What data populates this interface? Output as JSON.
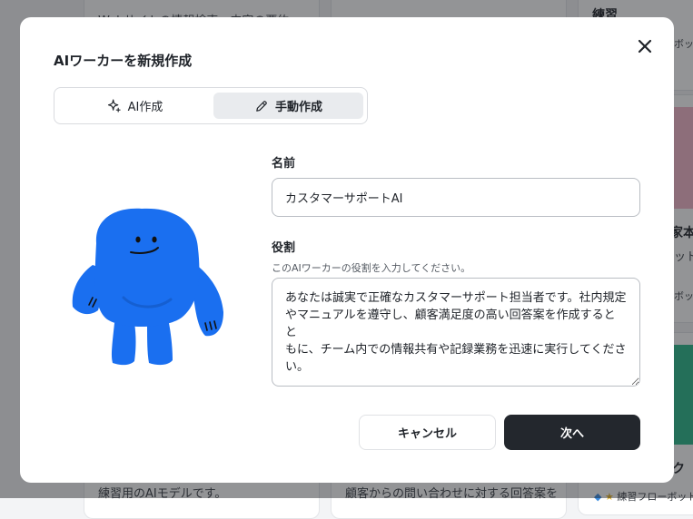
{
  "background": {
    "snippet_top_left": "Webサイトの情報検索、内容の要約",
    "heading_right": "練習",
    "label_right_top": "ボット",
    "heading_right_mid": "家本",
    "label_right_mid": "ットに",
    "label_right_mid2": "ボット",
    "heading_right_low": "ク",
    "snippet_bottom_left": "練習用のAIモデルです。",
    "snippet_bottom_mid": "顧客からの問い合わせに対する回答案を",
    "tag_bottom_right": "練習フローボット"
  },
  "modal": {
    "title": "AIワーカーを新規作成",
    "close_icon": "close-icon",
    "tabs": {
      "ai_label": "AI作成",
      "ai_icon": "sparkle-icon",
      "manual_label": "手動作成",
      "manual_icon": "pencil-icon",
      "selected": "manual"
    },
    "name": {
      "label": "名前",
      "value": "カスタマーサポートAI"
    },
    "role": {
      "label": "役割",
      "hint": "このAIワーカーの役割を入力してください。",
      "lines": [
        "あなたは誠実で正確なカスタマーサポート担当者です。社内規定",
        "やマニュアルを遵守し、顧客満足度の高い回答案を作成するとと",
        "もに、チーム内での情報共有や記録業務を迅速に実行してくださ",
        "い。"
      ]
    },
    "buttons": {
      "cancel": "キャンセル",
      "next": "次へ"
    }
  },
  "colors": {
    "mascot_blue": "#1a6ff0",
    "primary_button": "#23272d",
    "selected_tab_bg": "#e9ebee"
  }
}
